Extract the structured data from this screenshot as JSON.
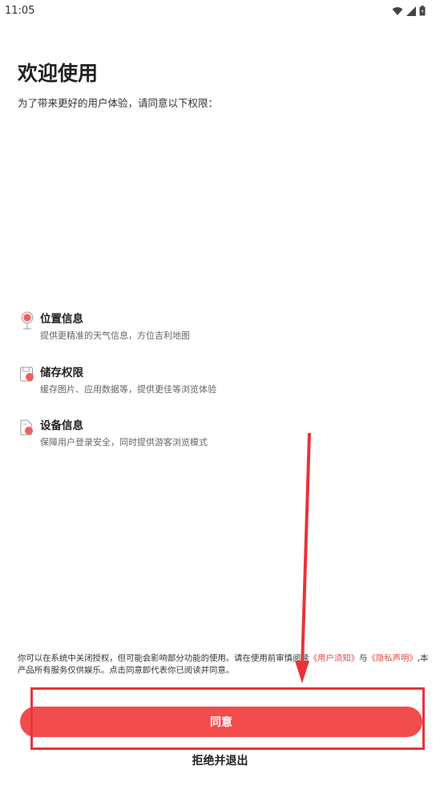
{
  "status_bar": {
    "time": "11:05"
  },
  "header": {
    "title": "欢迎使用",
    "subtitle": "为了带来更好的用户体验，请同意以下权限："
  },
  "permissions": [
    {
      "icon": "location-icon",
      "title": "位置信息",
      "desc": "提供更精准的天气信息，方位吉利地图"
    },
    {
      "icon": "storage-icon",
      "title": "储存权限",
      "desc": "缓存图片、应用数据等，提供更佳等浏览体验"
    },
    {
      "icon": "device-icon",
      "title": "设备信息",
      "desc": "保障用户登录安全，同时提供游客浏览模式"
    }
  ],
  "notice": {
    "text_before": "你可以在系统中关闭授权，但可能会影响部分功能的使用。请在使用前审慎阅读",
    "link_user": "《用户须知》",
    "text_and": "与",
    "link_privacy": "《隐私声明》",
    "text_after": ",本产品所有服务仅供娱乐。点击同意即代表你已阅读并同意。"
  },
  "buttons": {
    "agree": "同意",
    "refuse": "拒绝并退出"
  },
  "colors": {
    "accent": "#f24c4c",
    "annotation": "#e8333a"
  }
}
